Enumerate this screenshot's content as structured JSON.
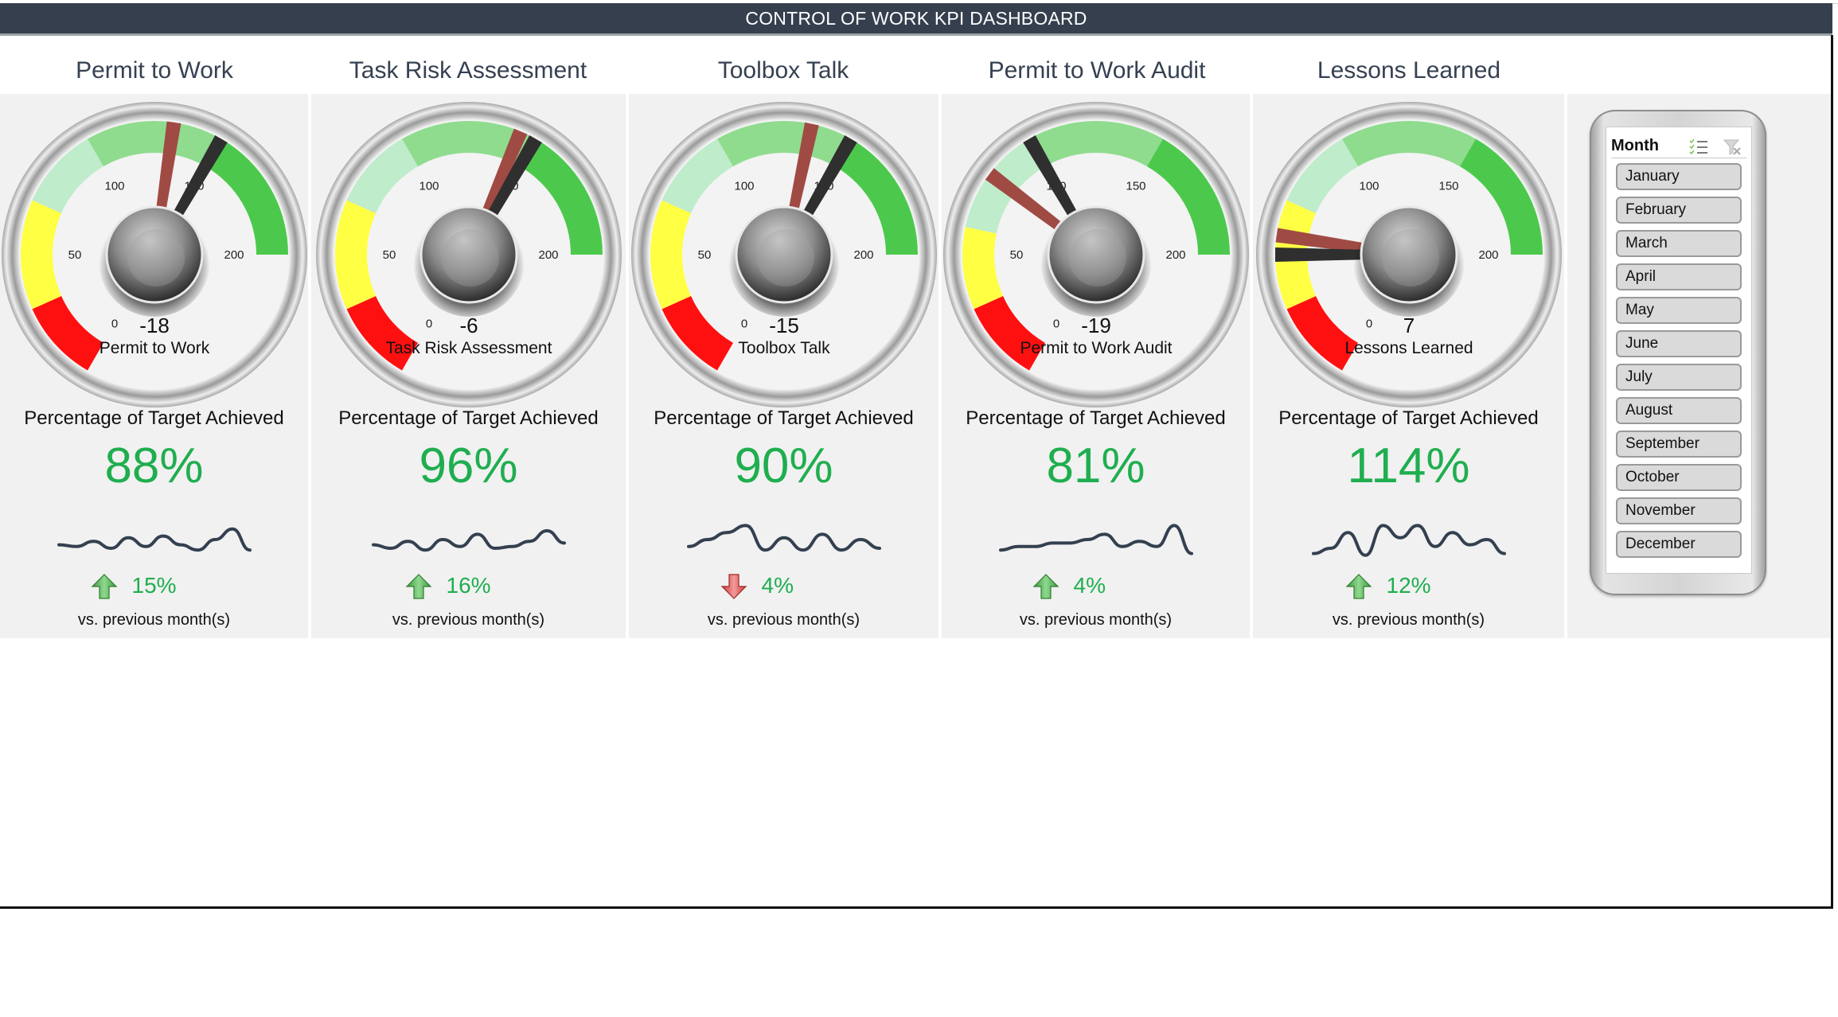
{
  "header": {
    "title": "CONTROL OF WORK KPI DASHBOARD"
  },
  "colors": {
    "header_bg": "#363f4e",
    "title_text": "#364152",
    "positive": "#1fae4f",
    "needle_actual": "#a04a44",
    "needle_target": "#2f2f2f",
    "sparkline": "#344050",
    "band_red": "#ff1010",
    "band_yellow": "#ffff44",
    "band_lightgreen": "#bfeccb",
    "band_midgreen": "#8fdc8f",
    "band_green": "#4cc94c"
  },
  "kpis": [
    {
      "title": "Permit to Work",
      "gauge": {
        "min": 0,
        "max": 200,
        "ticks": [
          "0",
          "50",
          "100",
          "150",
          "200"
        ],
        "actual": 132,
        "target": 150,
        "variance": "-18",
        "label": "Permit to Work",
        "bands": [
          [
            0,
            30,
            "red"
          ],
          [
            30,
            70,
            "yellow"
          ],
          [
            70,
            100,
            "lightgreen"
          ],
          [
            100,
            150,
            "midgreen"
          ],
          [
            150,
            200,
            "green"
          ]
        ]
      },
      "pct_label": "Percentage of Target Achieved",
      "pct_value": "88%",
      "trend": [
        0.35,
        0.3,
        0.45,
        0.25,
        0.55,
        0.3,
        0.6,
        0.35,
        0.2,
        0.5,
        0.8,
        0.2
      ],
      "delta_direction": "up",
      "delta_value": "15%",
      "vs_label": "vs. previous month(s)"
    },
    {
      "title": "Task Risk Assessment",
      "gauge": {
        "min": 0,
        "max": 200,
        "ticks": [
          "0",
          "50",
          "100",
          "150",
          "200"
        ],
        "actual": 144,
        "target": 150,
        "variance": "-6",
        "label": "Task Risk Assessment",
        "bands": [
          [
            0,
            30,
            "red"
          ],
          [
            30,
            70,
            "yellow"
          ],
          [
            70,
            100,
            "lightgreen"
          ],
          [
            100,
            150,
            "midgreen"
          ],
          [
            150,
            200,
            "green"
          ]
        ]
      },
      "pct_label": "Percentage of Target Achieved",
      "pct_value": "96%",
      "trend": [
        0.35,
        0.25,
        0.45,
        0.2,
        0.5,
        0.3,
        0.65,
        0.25,
        0.3,
        0.45,
        0.75,
        0.4
      ],
      "delta_direction": "up",
      "delta_value": "16%",
      "vs_label": "vs. previous month(s)"
    },
    {
      "title": "Toolbox Talk",
      "gauge": {
        "min": 0,
        "max": 200,
        "ticks": [
          "0",
          "50",
          "100",
          "150",
          "200"
        ],
        "actual": 135,
        "target": 150,
        "variance": "-15",
        "label": "Toolbox Talk",
        "bands": [
          [
            0,
            30,
            "red"
          ],
          [
            30,
            70,
            "yellow"
          ],
          [
            70,
            100,
            "lightgreen"
          ],
          [
            100,
            150,
            "midgreen"
          ],
          [
            150,
            200,
            "green"
          ]
        ]
      },
      "pct_label": "Percentage of Target Achieved",
      "pct_value": "90%",
      "trend": [
        0.3,
        0.5,
        0.7,
        0.9,
        0.2,
        0.55,
        0.2,
        0.65,
        0.2,
        0.5,
        0.25
      ],
      "delta_direction": "down",
      "delta_value": "4%",
      "vs_label": "vs. previous month(s)"
    },
    {
      "title": "Permit to Work Audit",
      "gauge": {
        "min": 0,
        "max": 200,
        "ticks": [
          "0",
          "50",
          "100",
          "150",
          "200"
        ],
        "actual": 81,
        "target": 100,
        "variance": "-19",
        "label": "Permit to Work Audit",
        "bands": [
          [
            0,
            30,
            "red"
          ],
          [
            30,
            60,
            "yellow"
          ],
          [
            60,
            100,
            "lightgreen"
          ],
          [
            100,
            150,
            "midgreen"
          ],
          [
            150,
            200,
            "green"
          ]
        ]
      },
      "pct_label": "Percentage of Target Achieved",
      "pct_value": "81%",
      "trend": [
        0.2,
        0.3,
        0.3,
        0.4,
        0.4,
        0.5,
        0.65,
        0.3,
        0.45,
        0.3,
        0.9,
        0.1
      ],
      "delta_direction": "up",
      "delta_value": "4%",
      "vs_label": "vs. previous month(s)"
    },
    {
      "title": "Lessons Learned",
      "gauge": {
        "min": 0,
        "max": 200,
        "ticks": [
          "0",
          "50",
          "100",
          "150",
          "200"
        ],
        "actual": 57,
        "target": 50,
        "variance": "7",
        "label": "Lessons Learned",
        "bands": [
          [
            0,
            30,
            "red"
          ],
          [
            30,
            70,
            "yellow"
          ],
          [
            70,
            100,
            "lightgreen"
          ],
          [
            100,
            150,
            "midgreen"
          ],
          [
            150,
            200,
            "green"
          ]
        ]
      },
      "pct_label": "Percentage of Target Achieved",
      "pct_value": "114%",
      "trend": [
        0.1,
        0.25,
        0.7,
        0.05,
        0.9,
        0.55,
        0.9,
        0.3,
        0.7,
        0.35,
        0.5,
        0.1
      ],
      "delta_direction": "up",
      "delta_value": "12%",
      "vs_label": "vs. previous month(s)"
    }
  ],
  "slicer": {
    "title": "Month",
    "multiselect_icon": "multi-select-icon",
    "clear_icon": "clear-filter-icon",
    "items": [
      "January",
      "February",
      "March",
      "April",
      "May",
      "June",
      "July",
      "August",
      "September",
      "October",
      "November",
      "December"
    ]
  }
}
